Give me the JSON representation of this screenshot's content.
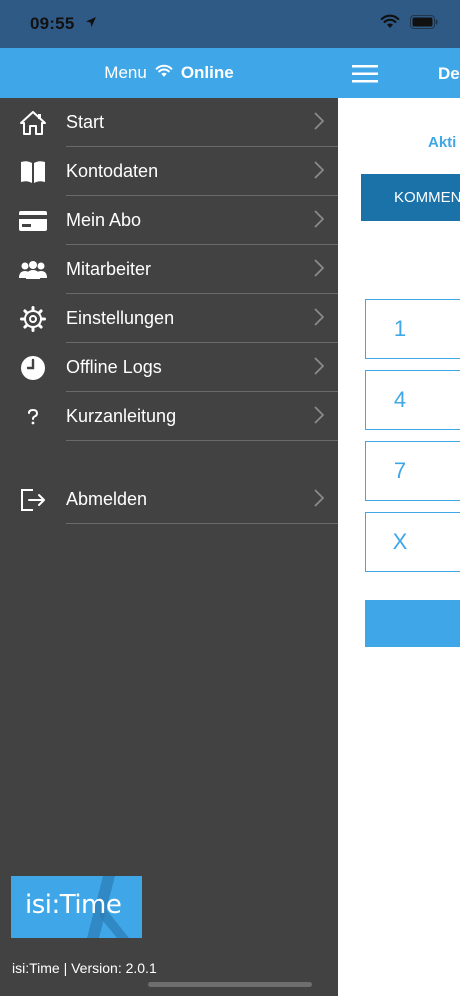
{
  "status_bar": {
    "time": "09:55"
  },
  "drawer": {
    "header": {
      "title": "Menu",
      "connection": "Online"
    },
    "items": [
      {
        "label": "Start",
        "icon": "home-icon"
      },
      {
        "label": "Kontodaten",
        "icon": "book-icon"
      },
      {
        "label": "Mein Abo",
        "icon": "credit-card-icon"
      },
      {
        "label": "Mitarbeiter",
        "icon": "users-icon"
      },
      {
        "label": "Einstellungen",
        "icon": "gear-icon"
      },
      {
        "label": "Offline Logs",
        "icon": "clock-icon"
      },
      {
        "label": "Kurzanleitung",
        "icon": "question-icon"
      }
    ],
    "logout": {
      "label": "Abmelden",
      "icon": "logout-icon"
    },
    "logo_text": "isi:Time",
    "version": "isi:Time | Version: 2.0.1"
  },
  "main": {
    "title": "De",
    "status": "Akti",
    "kommen_label": "KOMMEN",
    "keypad": [
      "1",
      "4",
      "7",
      "X"
    ]
  },
  "colors": {
    "accent": "#3fa7e8",
    "drawer_bg": "#424242",
    "button_dark": "#1a72a8",
    "status_bar": "#2f5a86"
  }
}
